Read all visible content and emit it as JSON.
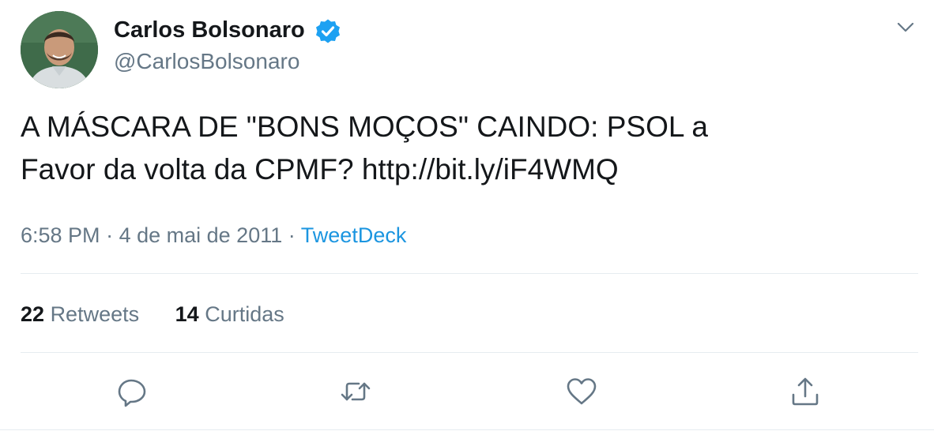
{
  "author": {
    "display_name": "Carlos Bolsonaro",
    "handle": "@CarlosBolsonaro",
    "verified": true,
    "avatar_icon": "profile-photo"
  },
  "tweet": {
    "text": "A MÁSCARA DE \"BONS MOÇOS\" CAINDO: PSOL a\nFavor da volta da CPMF? http://bit.ly/iF4WMQ",
    "time": "6:58 PM",
    "separator": "·",
    "date": "4 de mai de 2011",
    "source": "TweetDeck"
  },
  "stats": {
    "retweets_count": "22",
    "retweets_label": "Retweets",
    "likes_count": "14",
    "likes_label": "Curtidas"
  },
  "actions": {
    "reply_icon": "reply-icon",
    "retweet_icon": "retweet-icon",
    "like_icon": "heart-icon",
    "share_icon": "share-icon"
  },
  "colors": {
    "text_primary": "#14171a",
    "text_secondary": "#657786",
    "link": "#1b95e0",
    "verified_badge": "#1da1f2",
    "divider": "#e6ecf0"
  }
}
